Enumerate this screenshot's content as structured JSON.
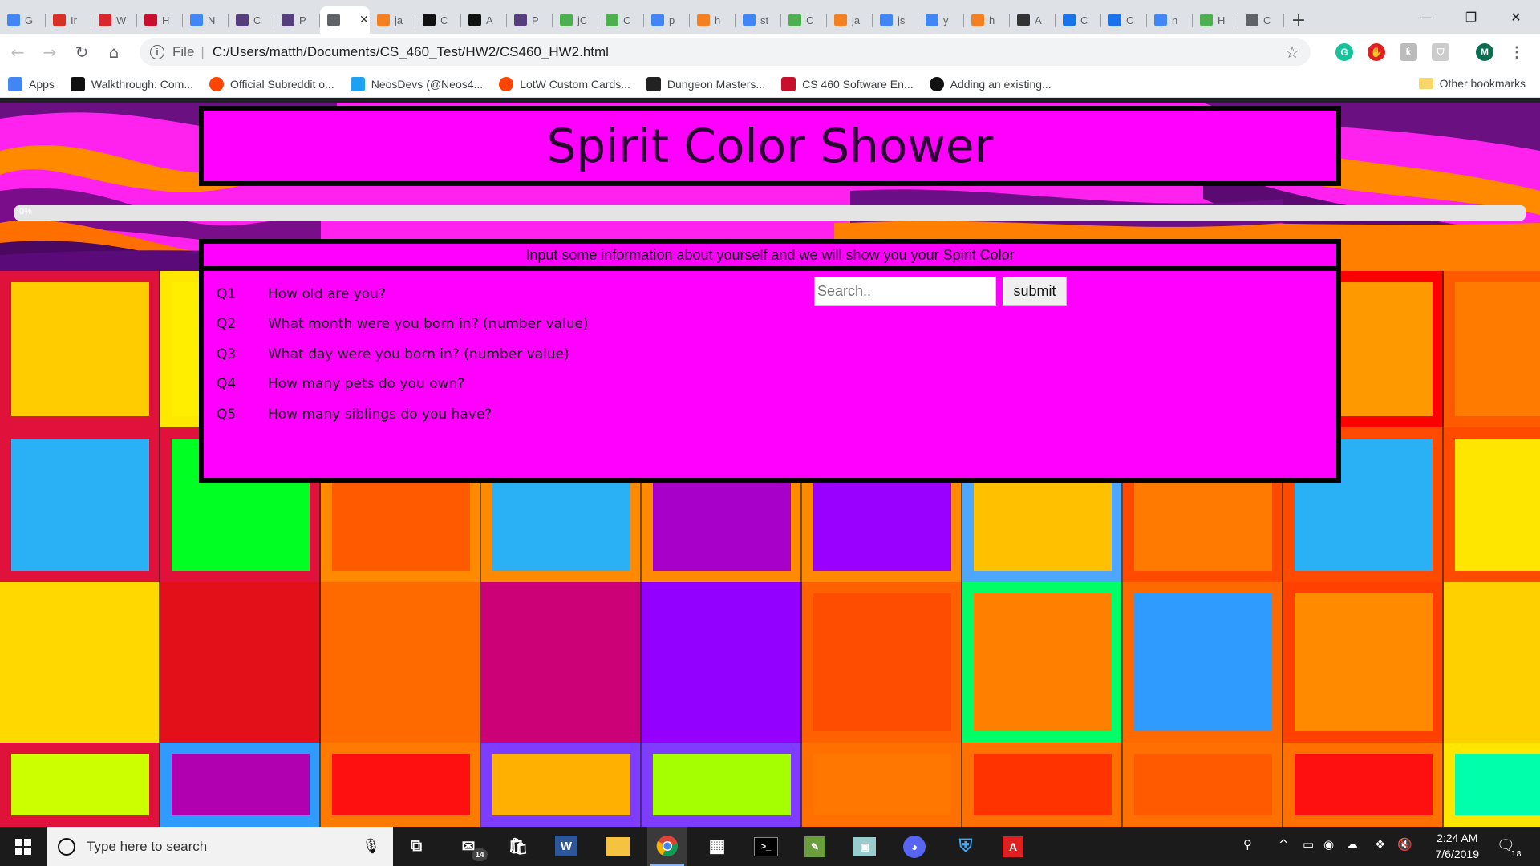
{
  "browser": {
    "tabs": [
      {
        "icon": "google-icon",
        "letter": "G",
        "color": "#4285f4"
      },
      {
        "icon": "gmail-icon",
        "letter": "Ir",
        "color": "#d93025"
      },
      {
        "icon": "mega-icon",
        "letter": "W",
        "color": "#d9272e"
      },
      {
        "icon": "shield-icon",
        "letter": "H",
        "color": "#c8102e"
      },
      {
        "icon": "docs-icon",
        "letter": "N",
        "color": "#4285f4"
      },
      {
        "icon": "b-icon",
        "letter": "C",
        "color": "#563d7c"
      },
      {
        "icon": "b-icon",
        "letter": "P",
        "color": "#563d7c"
      },
      {
        "icon": "globe-icon",
        "letter": "",
        "color": "#5f6368",
        "active": true
      },
      {
        "icon": "stackoverflow-icon",
        "letter": "ja",
        "color": "#f48024"
      },
      {
        "icon": "github-icon",
        "letter": "C",
        "color": "#111111"
      },
      {
        "icon": "github-icon",
        "letter": "A",
        "color": "#111111"
      },
      {
        "icon": "b-icon",
        "letter": "P",
        "color": "#563d7c"
      },
      {
        "icon": "w3schools-icon",
        "letter": "jC",
        "color": "#4caf50"
      },
      {
        "icon": "w3schools-icon",
        "letter": "C",
        "color": "#4caf50"
      },
      {
        "icon": "google-icon",
        "letter": "p",
        "color": "#4285f4"
      },
      {
        "icon": "stackoverflow-icon",
        "letter": "h",
        "color": "#f48024"
      },
      {
        "icon": "google-icon",
        "letter": "st",
        "color": "#4285f4"
      },
      {
        "icon": "w3schools-icon",
        "letter": "C",
        "color": "#4caf50"
      },
      {
        "icon": "stackoverflow-icon",
        "letter": "ja",
        "color": "#f48024"
      },
      {
        "icon": "google-icon",
        "letter": "js",
        "color": "#4285f4"
      },
      {
        "icon": "google-icon",
        "letter": "y",
        "color": "#4285f4"
      },
      {
        "icon": "stackoverflow-icon",
        "letter": "h",
        "color": "#f48024"
      },
      {
        "icon": "wikipedia-icon",
        "letter": "A",
        "color": "#333333"
      },
      {
        "icon": "drive-icon",
        "letter": "C",
        "color": "#1a73e8"
      },
      {
        "icon": "drive-icon",
        "letter": "C",
        "color": "#1a73e8"
      },
      {
        "icon": "google-icon",
        "letter": "h",
        "color": "#4285f4"
      },
      {
        "icon": "w3schools-icon",
        "letter": "H",
        "color": "#4caf50"
      },
      {
        "icon": "globe-icon",
        "letter": "C",
        "color": "#5f6368"
      }
    ],
    "new_tab": "+",
    "address": {
      "scheme": "File",
      "path": "C:/Users/matth/Documents/CS_460_Test/HW2/CS460_HW2.html"
    },
    "profile_letter": "M",
    "bookmarks": [
      {
        "icon": "apps-icon",
        "label": "Apps"
      },
      {
        "icon": "m-icon",
        "label": "Walkthrough: Com..."
      },
      {
        "icon": "reddit-icon",
        "label": "Official Subreddit o..."
      },
      {
        "icon": "twitter-icon",
        "label": "NeosDevs (@Neos4..."
      },
      {
        "icon": "reddit-icon",
        "label": "LotW Custom Cards..."
      },
      {
        "icon": "dnd-icon",
        "label": "Dungeon Masters..."
      },
      {
        "icon": "shield-icon",
        "label": "CS 460 Software En..."
      },
      {
        "icon": "github-icon",
        "label": "Adding an existing..."
      }
    ],
    "other_bookmarks": "Other bookmarks"
  },
  "page": {
    "title": "Spirit Color Shower",
    "progress": {
      "label": "0%",
      "fraction": 0
    },
    "form": {
      "heading": "Input some information about yourself and we will show you your Spirit Color",
      "questions": [
        {
          "num": "Q1",
          "text": "How old are you?"
        },
        {
          "num": "Q2",
          "text": "What month were you born in? (number value)"
        },
        {
          "num": "Q3",
          "text": "What day were you born in? (number value)"
        },
        {
          "num": "Q4",
          "text": "How many pets do you own?"
        },
        {
          "num": "Q5",
          "text": "How many siblings do you have?"
        }
      ],
      "search_placeholder": "Search..",
      "submit_label": "submit"
    },
    "colors": {
      "panel": "#ff00ff",
      "border": "#000000"
    }
  },
  "taskbar": {
    "search_placeholder": "Type here to search",
    "mail_badge": "14",
    "time": "2:24 AM",
    "date": "7/6/2019",
    "notification_count": "18"
  }
}
